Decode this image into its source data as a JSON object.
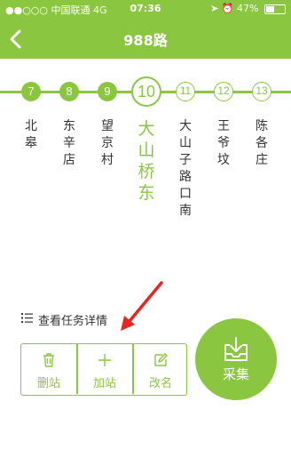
{
  "status_bar": {
    "carrier": "●●○○○ 中国联通  4G",
    "time": "07:36",
    "battery": "47%",
    "battery_level": 0.47
  },
  "header": {
    "title": "988路",
    "back_icon": "chevron-left-icon"
  },
  "route": {
    "stops": [
      {
        "number": "7",
        "name": "北皋",
        "state": "passed"
      },
      {
        "number": "8",
        "name": "东辛店",
        "state": "passed"
      },
      {
        "number": "9",
        "name": "望京村",
        "state": "passed"
      },
      {
        "number": "10",
        "name": "大山桥东",
        "state": "current"
      },
      {
        "number": "11",
        "name": "大山子路口南",
        "state": "upcoming"
      },
      {
        "number": "12",
        "name": "王爷坟",
        "state": "upcoming"
      },
      {
        "number": "13",
        "name": "陈各庄",
        "state": "upcoming"
      }
    ]
  },
  "task": {
    "detail_label": "查看任务详情",
    "icon": "list-icon"
  },
  "actions": {
    "delete_label": "删站",
    "add_label": "加站",
    "rename_label": "改名",
    "delete_icon": "trash-icon",
    "add_icon": "plus-icon",
    "rename_icon": "edit-icon"
  },
  "collect": {
    "label": "采集",
    "icon": "download-tray-icon"
  },
  "colors": {
    "accent": "#8ac63f",
    "annotation": "#e8251f"
  }
}
